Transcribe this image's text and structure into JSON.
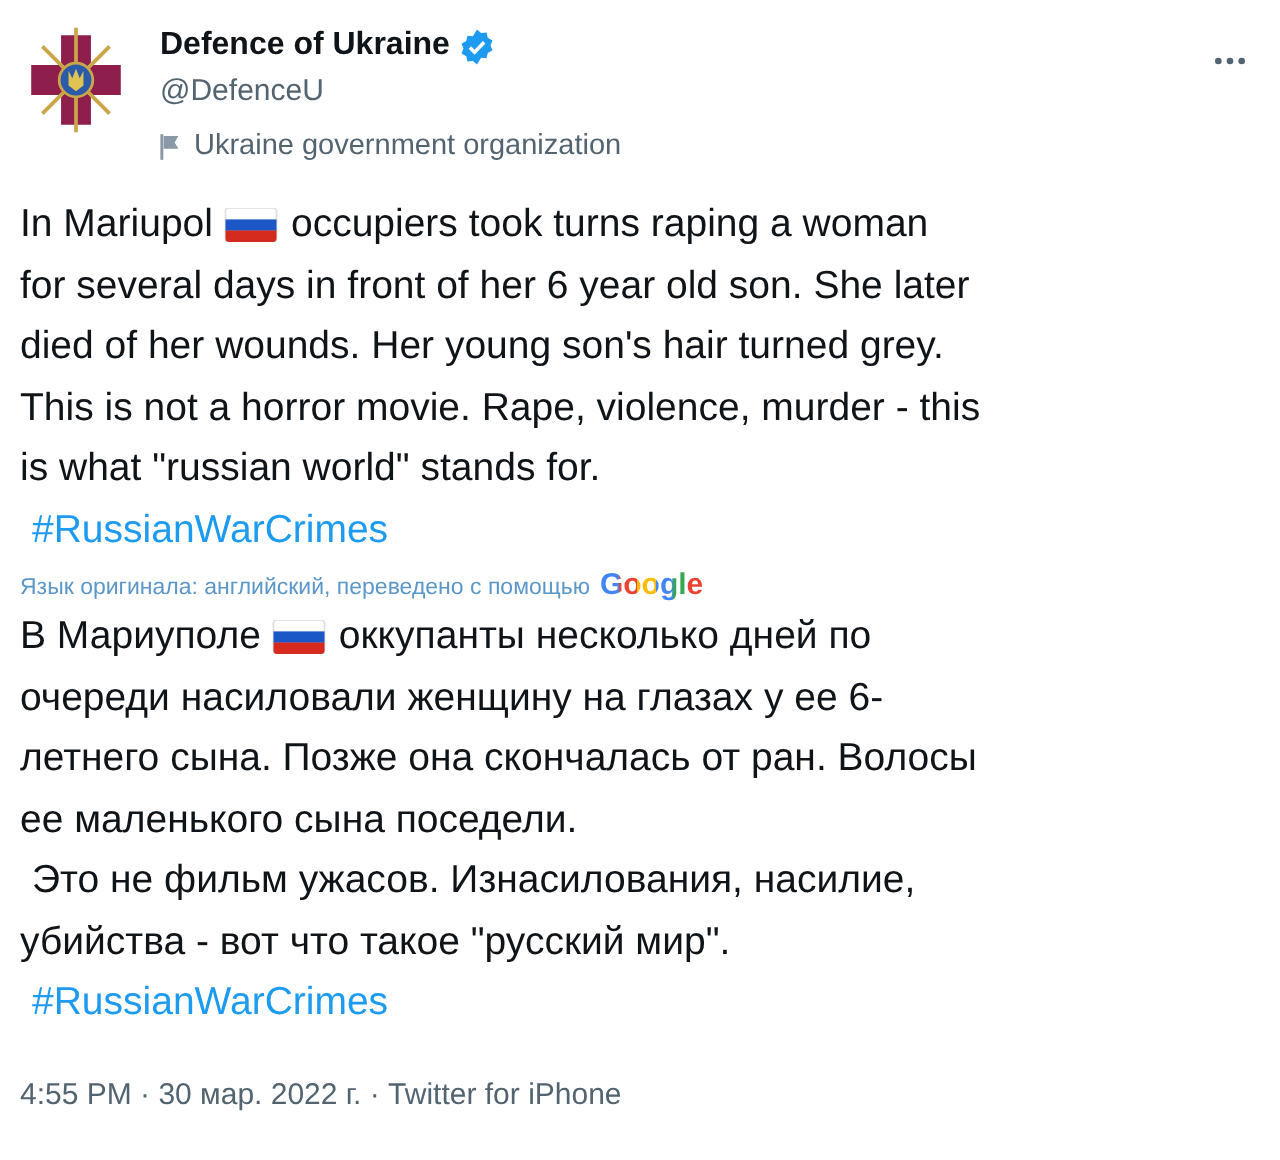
{
  "author": {
    "name": "Defence of Ukraine",
    "verified": true,
    "handle": "@DefenceU",
    "label": "Ukraine government organization"
  },
  "original": [
    {
      "kind": "text",
      "parts": [
        {
          "kind": "text",
          "text": "In Mariupol"
        },
        {
          "kind": "flag"
        },
        {
          "kind": "text",
          "text": "occupiers took turns raping a woman"
        }
      ]
    },
    {
      "kind": "text",
      "parts": [
        {
          "kind": "text",
          "text": "for several days in front of her 6 year old son. She later"
        }
      ]
    },
    {
      "kind": "text",
      "parts": [
        {
          "kind": "text",
          "text": "died of her wounds. Her young son's hair turned grey."
        }
      ]
    },
    {
      "kind": "text",
      "parts": [
        {
          "kind": "text",
          "text": "This is not a horror movie. Rape, violence, murder - this"
        }
      ]
    },
    {
      "kind": "text",
      "parts": [
        {
          "kind": "text",
          "text": "is what \"russian world\" stands for."
        }
      ]
    },
    {
      "kind": "hashtag",
      "text": "#RussianWarCrimes"
    }
  ],
  "translation_note": {
    "text": "Язык оригинала: английский, переведено с помощью",
    "provider": "Google"
  },
  "translated": [
    {
      "kind": "text",
      "parts": [
        {
          "kind": "text",
          "text": "В Мариуполе"
        },
        {
          "kind": "flag"
        },
        {
          "kind": "text",
          "text": "оккупанты несколько дней по"
        }
      ]
    },
    {
      "kind": "text",
      "parts": [
        {
          "kind": "text",
          "text": "очереди насиловали женщину на глазах у ее 6-"
        }
      ]
    },
    {
      "kind": "text",
      "parts": [
        {
          "kind": "text",
          "text": "летнего сына. Позже она скончалась от ран. Волосы"
        }
      ]
    },
    {
      "kind": "text",
      "parts": [
        {
          "kind": "text",
          "text": "ее маленького сына поседели."
        }
      ]
    },
    {
      "kind": "indented",
      "parts": [
        {
          "kind": "text",
          "text": "Это не фильм ужасов. Изнасилования, насилие,"
        }
      ]
    },
    {
      "kind": "text",
      "parts": [
        {
          "kind": "text",
          "text": "убийства - вот что такое \"русский мир\"."
        }
      ]
    },
    {
      "kind": "hashtag",
      "text": "#RussianWarCrimes"
    }
  ],
  "footer": "4:55 PM · 30 мар. 2022 г. · Twitter for iPhone"
}
